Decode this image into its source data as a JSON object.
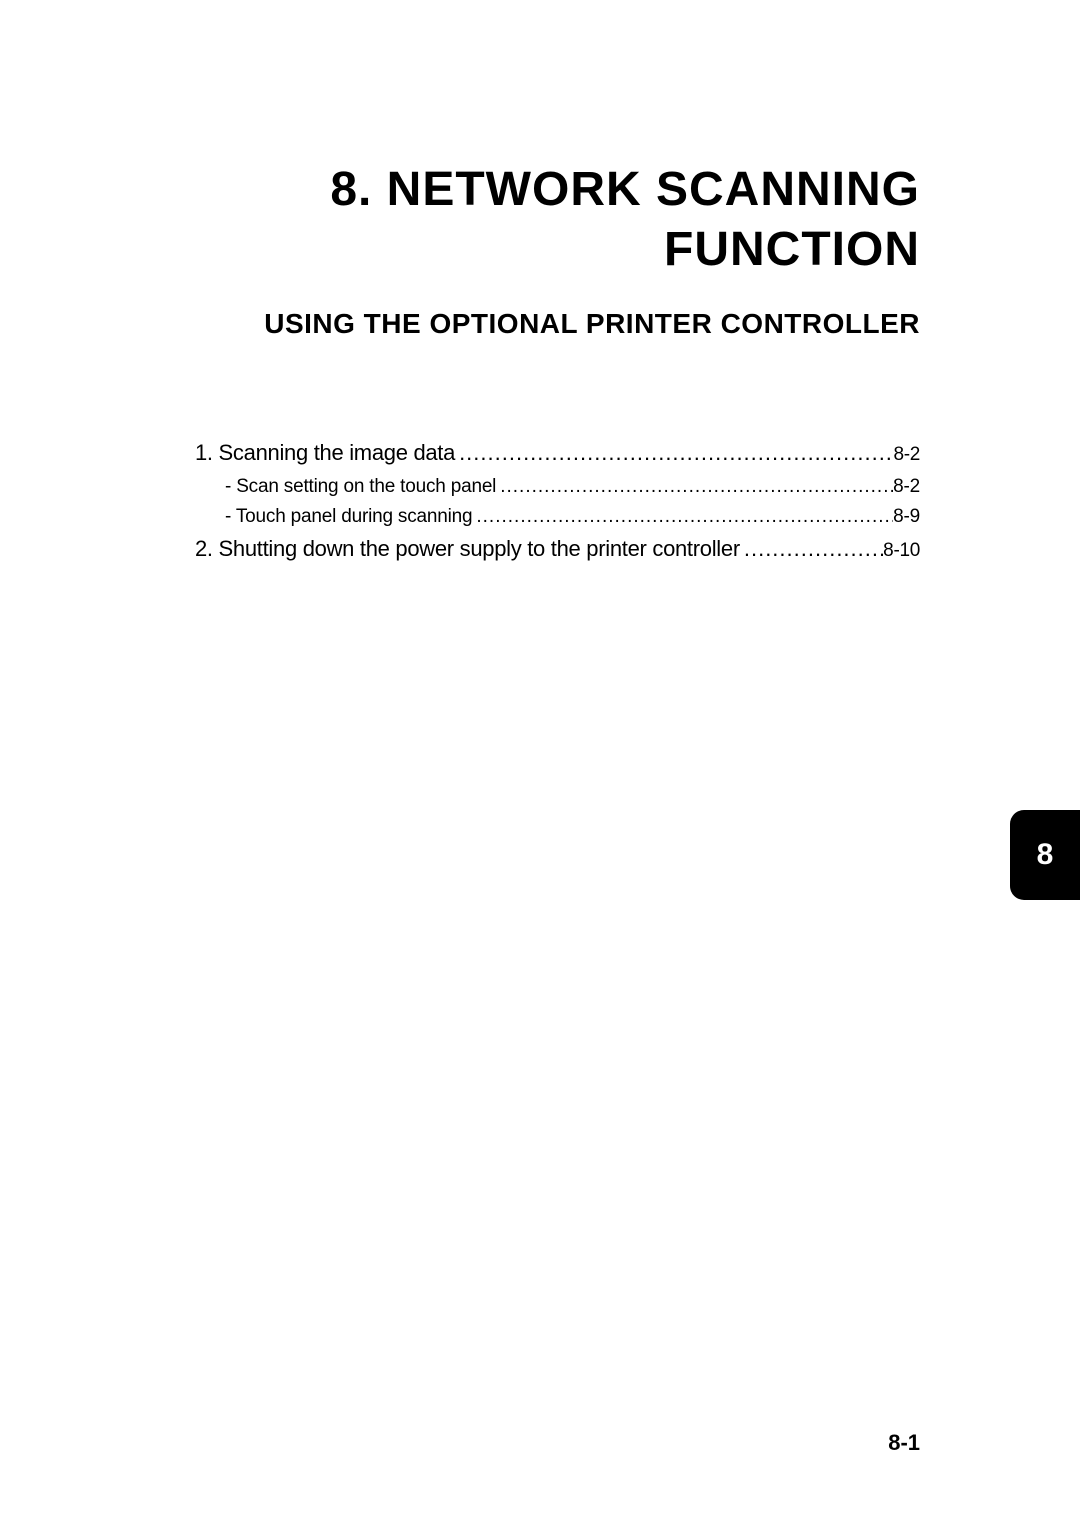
{
  "chapter": {
    "title": "8. NETWORK SCANNING FUNCTION",
    "subtitle": "USING THE OPTIONAL PRINTER CONTROLLER"
  },
  "toc": {
    "item1": {
      "label": "1. Scanning the image data",
      "page": "8-2",
      "sub1": {
        "label": "- Scan setting on the touch panel",
        "page": "8-2"
      },
      "sub2": {
        "label": "- Touch panel during scanning",
        "page": "8-9"
      }
    },
    "item2": {
      "label": "2. Shutting down the power supply to the printer controller",
      "page": "8-10"
    }
  },
  "tab": "8",
  "page_number": "8-1"
}
